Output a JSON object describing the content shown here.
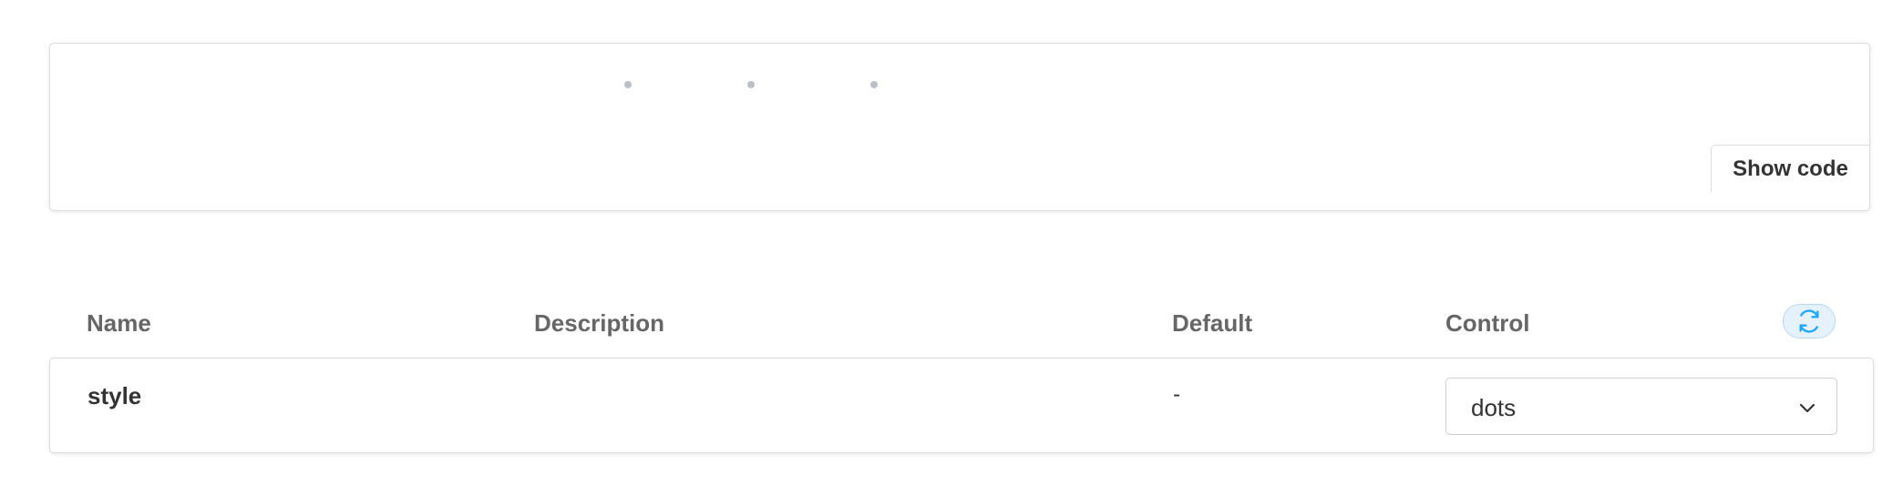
{
  "preview": {
    "show_code_label": "Show code",
    "loader_style": "dots"
  },
  "args_table": {
    "headers": {
      "name": "Name",
      "description": "Description",
      "default": "Default",
      "control": "Control"
    },
    "reset_icon": "refresh-icon",
    "rows": [
      {
        "name": "style",
        "description": "",
        "default": "-",
        "control": {
          "type": "select",
          "selected": "dots",
          "icon": "chevron-down-icon"
        }
      }
    ]
  },
  "colors": {
    "dot": "#b9c0c8",
    "reset_icon": "#1ea7fd",
    "reset_bg": "#e6f2fb",
    "border": "#dcdcdc"
  }
}
